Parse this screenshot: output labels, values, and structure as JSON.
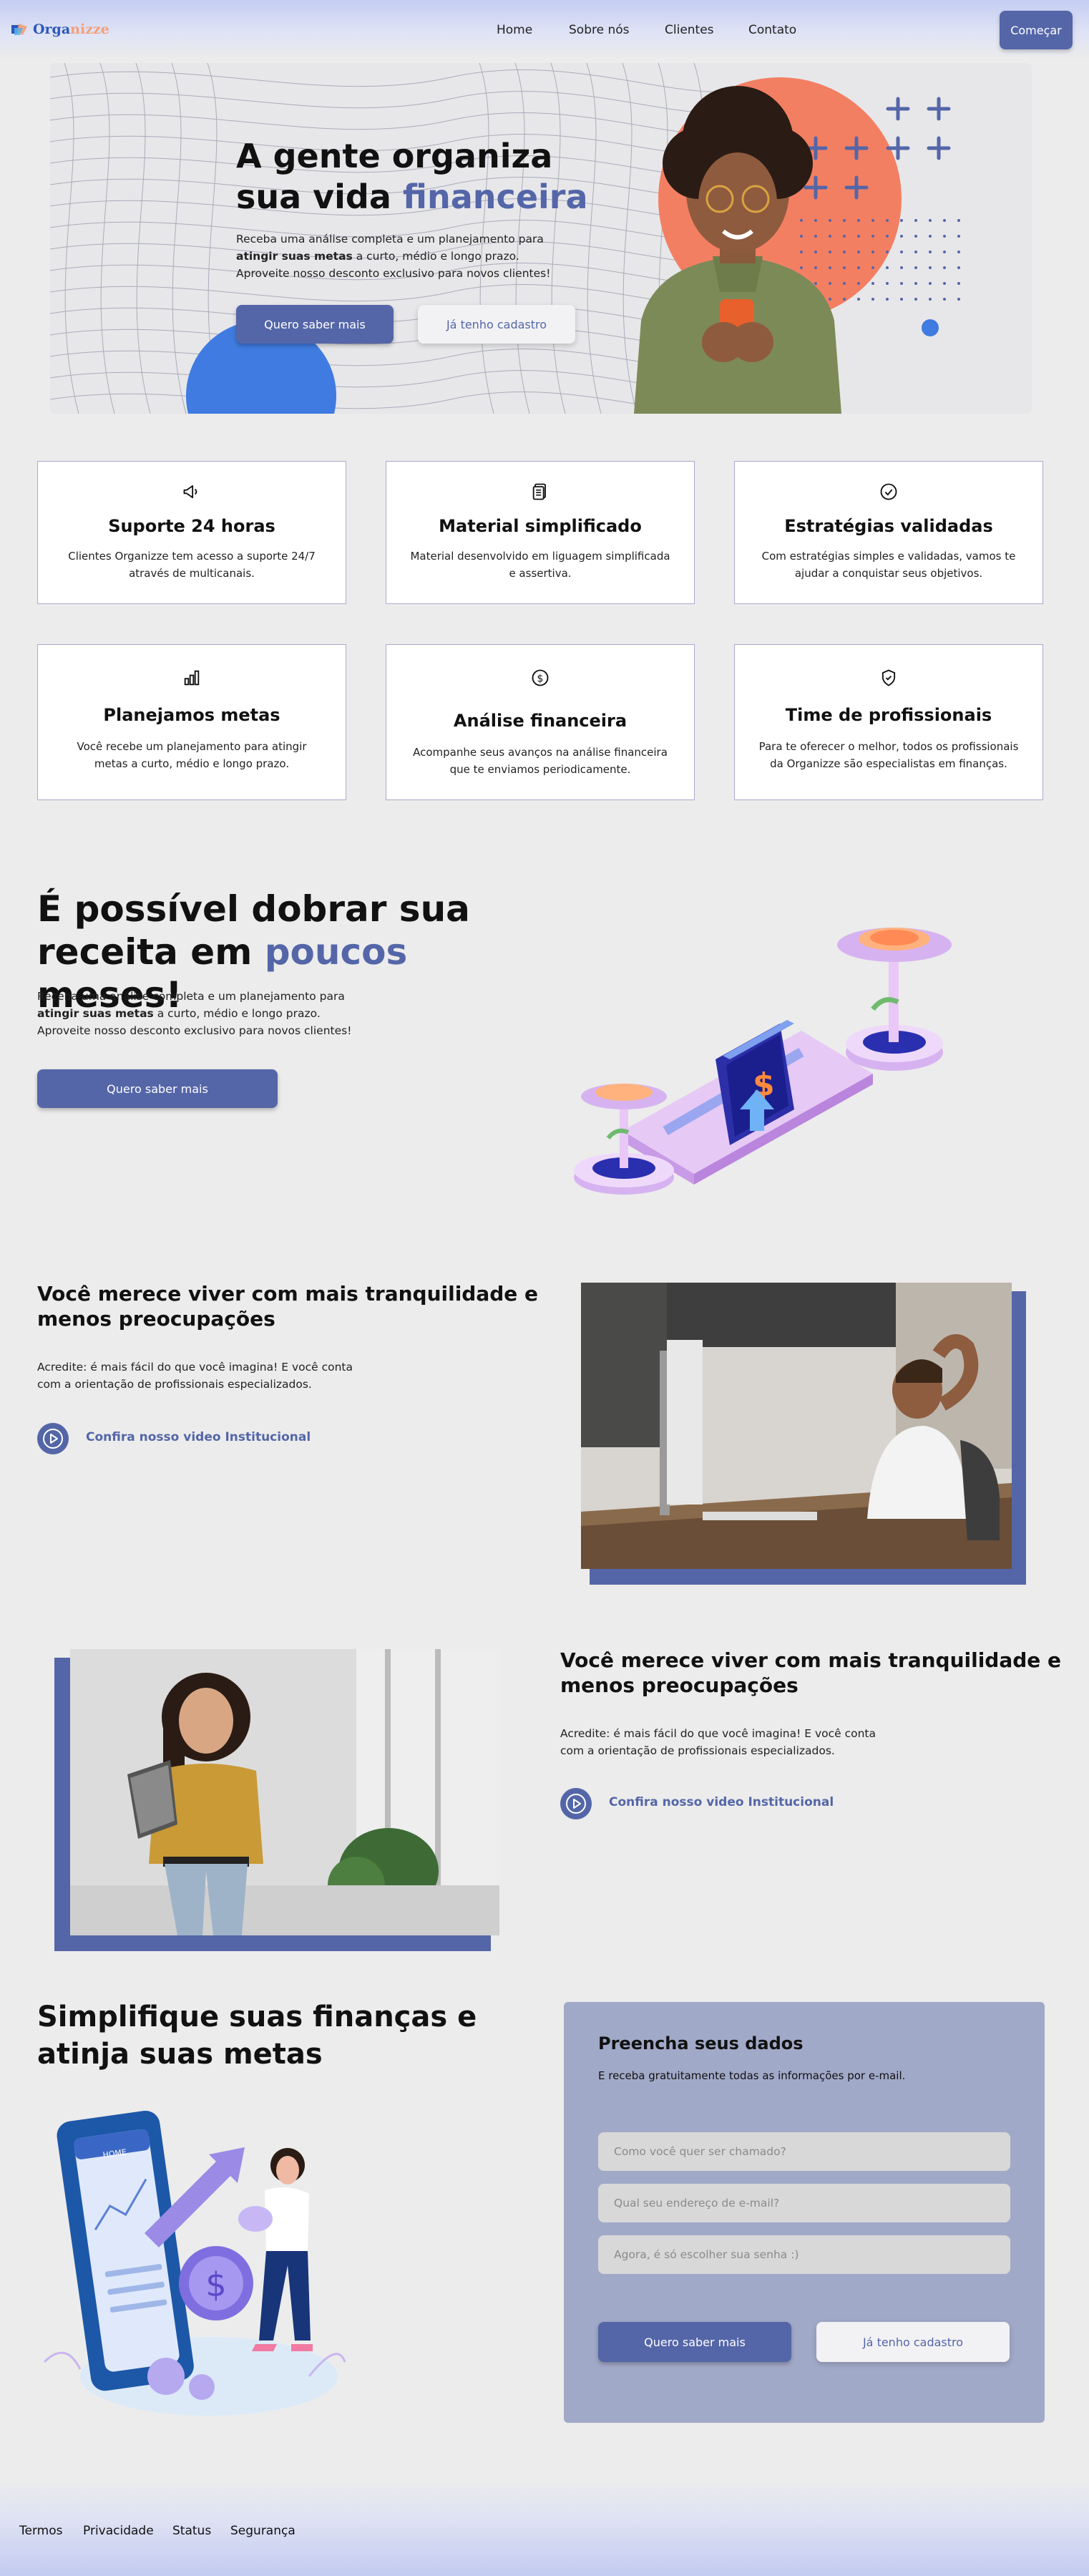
{
  "nav": {
    "logo_part1": "Orga",
    "logo_part2": "nizze",
    "links": [
      "Home",
      "Sobre nós",
      "Clientes",
      "Contato"
    ],
    "cta": "Começar"
  },
  "hero": {
    "title_line1": "A gente organiza",
    "title_line2_plain": "sua vida ",
    "title_line2_accent": "financeira",
    "text_line1": "Receba uma análise completa e um planejamento para",
    "text_line2_bold": "atingir suas metas",
    "text_line2_rest": " a curto, médio e longo prazo.",
    "text_line3": "Aproveite nosso desconto exclusivo para novos clientes!",
    "btn_primary": "Quero saber mais",
    "btn_secondary": "Já tenho cadastro"
  },
  "features": [
    {
      "icon": "megaphone-icon",
      "title": "Suporte 24 horas",
      "text": "Clientes Organizze tem acesso a suporte 24/7 através de multicanais."
    },
    {
      "icon": "document-icon",
      "title": "Material simplificado",
      "text": "Material desenvolvido em liguagem simplificada e assertiva."
    },
    {
      "icon": "check-circle-icon",
      "title": "Estratégias validadas",
      "text": "Com estratégias simples e validadas, vamos te ajudar a conquistar seus objetivos."
    },
    {
      "icon": "bar-chart-icon",
      "title": "Planejamos metas",
      "text": "Você recebe um planejamento para atingir metas a curto, médio e longo prazo."
    },
    {
      "icon": "dollar-circle-icon",
      "title": "Análise financeira",
      "text": "Acompanhe seus avanços na análise financeira que te enviamos periodicamente."
    },
    {
      "icon": "shield-check-icon",
      "title": "Time de profissionais",
      "text": "Para te oferecer o melhor, todos os profissionais da Organizze são especialistas em finanças."
    }
  ],
  "double": {
    "title_line1": "É possível dobrar sua",
    "title_line2_plain": "receita em ",
    "title_line2_accent": "poucos",
    "title_line2_end": " meses!",
    "text_line1": "Receba uma análise completa e um planejamento para",
    "text_line2_bold": "atingir suas metas",
    "text_line2_rest": " a curto, médio e longo prazo.",
    "text_line3": "Aproveite nosso desconto exclusivo para novos clientes!",
    "btn": "Quero saber mais"
  },
  "calm1": {
    "title_line1": "Você merece viver com mais tranquilidade e",
    "title_line2": "menos preocupações",
    "text_line1": "Acredite: é mais fácil do que você imagina! E você conta",
    "text_line2": "com a orientação de profissionais especializados.",
    "video_link": "Confira nosso video Institucional"
  },
  "calm2": {
    "title_line1": "Você merece viver com mais tranquilidade e",
    "title_line2": "menos preocupações",
    "text_line1": "Acredite: é mais fácil do que você imagina! E você conta",
    "text_line2": "com a orientação de profissionais especializados.",
    "video_link": "Confira nosso video Institucional"
  },
  "simplify": {
    "title_line1": "Simplifique suas finanças e",
    "title_line2": "atinja suas metas",
    "phone_header": "HOME"
  },
  "form": {
    "title": "Preencha seus dados",
    "subtitle": "E receba gratuitamente todas as informações por e-mail.",
    "name_placeholder": "Como você quer ser chamado?",
    "email_placeholder": "Qual seu endereço de e-mail?",
    "password_placeholder": "Agora, é só escolher sua senha :)",
    "btn_primary": "Quero saber mais",
    "btn_secondary": "Já tenho cadastro"
  },
  "footer": {
    "links": [
      "Termos",
      "Privacidade",
      "Status",
      "Segurança"
    ]
  },
  "colors": {
    "accent": "#5466a8",
    "coral": "#f37f63",
    "blue": "#3f7be0",
    "form_bg": "#a1a9c8"
  }
}
